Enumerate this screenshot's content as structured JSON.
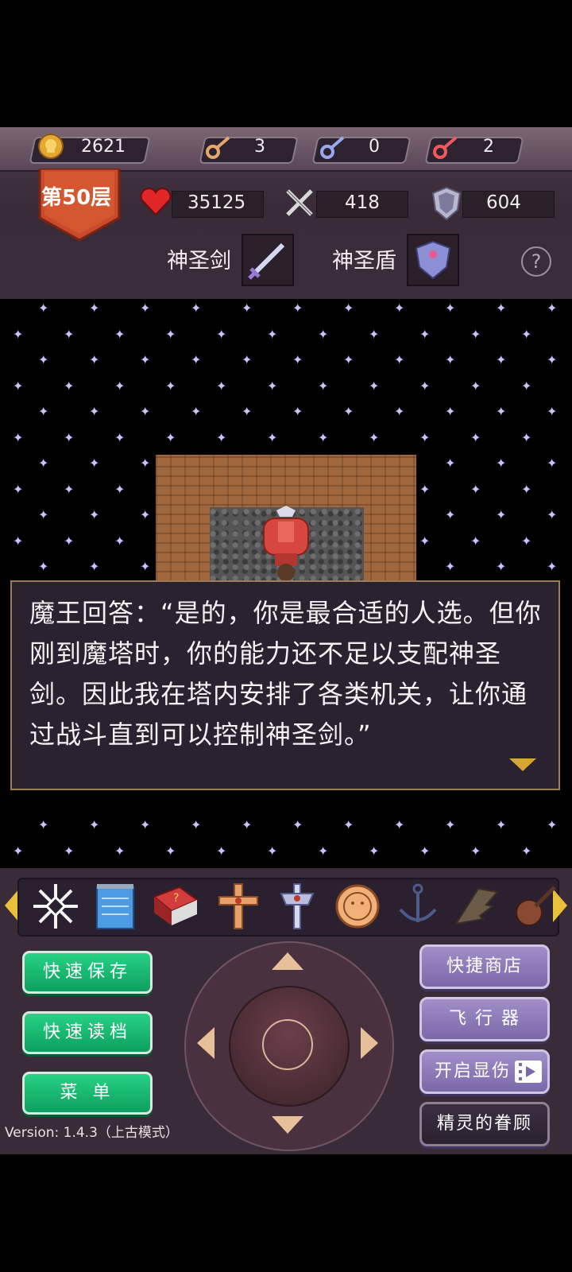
{
  "resources": {
    "gold": "2621",
    "yellow_keys": "3",
    "blue_keys": "0",
    "red_keys": "2"
  },
  "floor": {
    "label": "第50层"
  },
  "stats": {
    "hp": "35125",
    "attack": "418",
    "defense": "604"
  },
  "equipment": {
    "weapon_label": "神圣剑",
    "shield_label": "神圣盾"
  },
  "help_label": "?",
  "dialog": {
    "text": "魔王回答：“是的，你是最合适的人选。但你刚到魔塔时，你的能力还不足以支配神圣剑。因此我在塔内安排了各类机关，让你通过战斗直到可以控制神圣剑。”"
  },
  "items": [
    "snowflake-icon",
    "notepad-icon",
    "red-book-icon",
    "holy-cross-icon",
    "silver-cross-icon",
    "coin-face-icon",
    "anchor-icon",
    "wing-icon",
    "lute-icon"
  ],
  "left_buttons": {
    "quick_save": "快速保存",
    "quick_load": "快速读档",
    "menu": "菜 单"
  },
  "right_buttons": {
    "quick_shop": "快捷商店",
    "flyer": "飞 行 器",
    "show_damage": "开启显伤",
    "spirit_favor": "精灵的眷顾"
  },
  "version": "Version: 1.4.3（上古模式）",
  "colors": {
    "green_button": "#18b872",
    "purple_button": "#8a78b9",
    "dialog_bg": "#2b2230",
    "dialog_border": "#9a7e5a",
    "banner_red": "#c94a2c"
  }
}
